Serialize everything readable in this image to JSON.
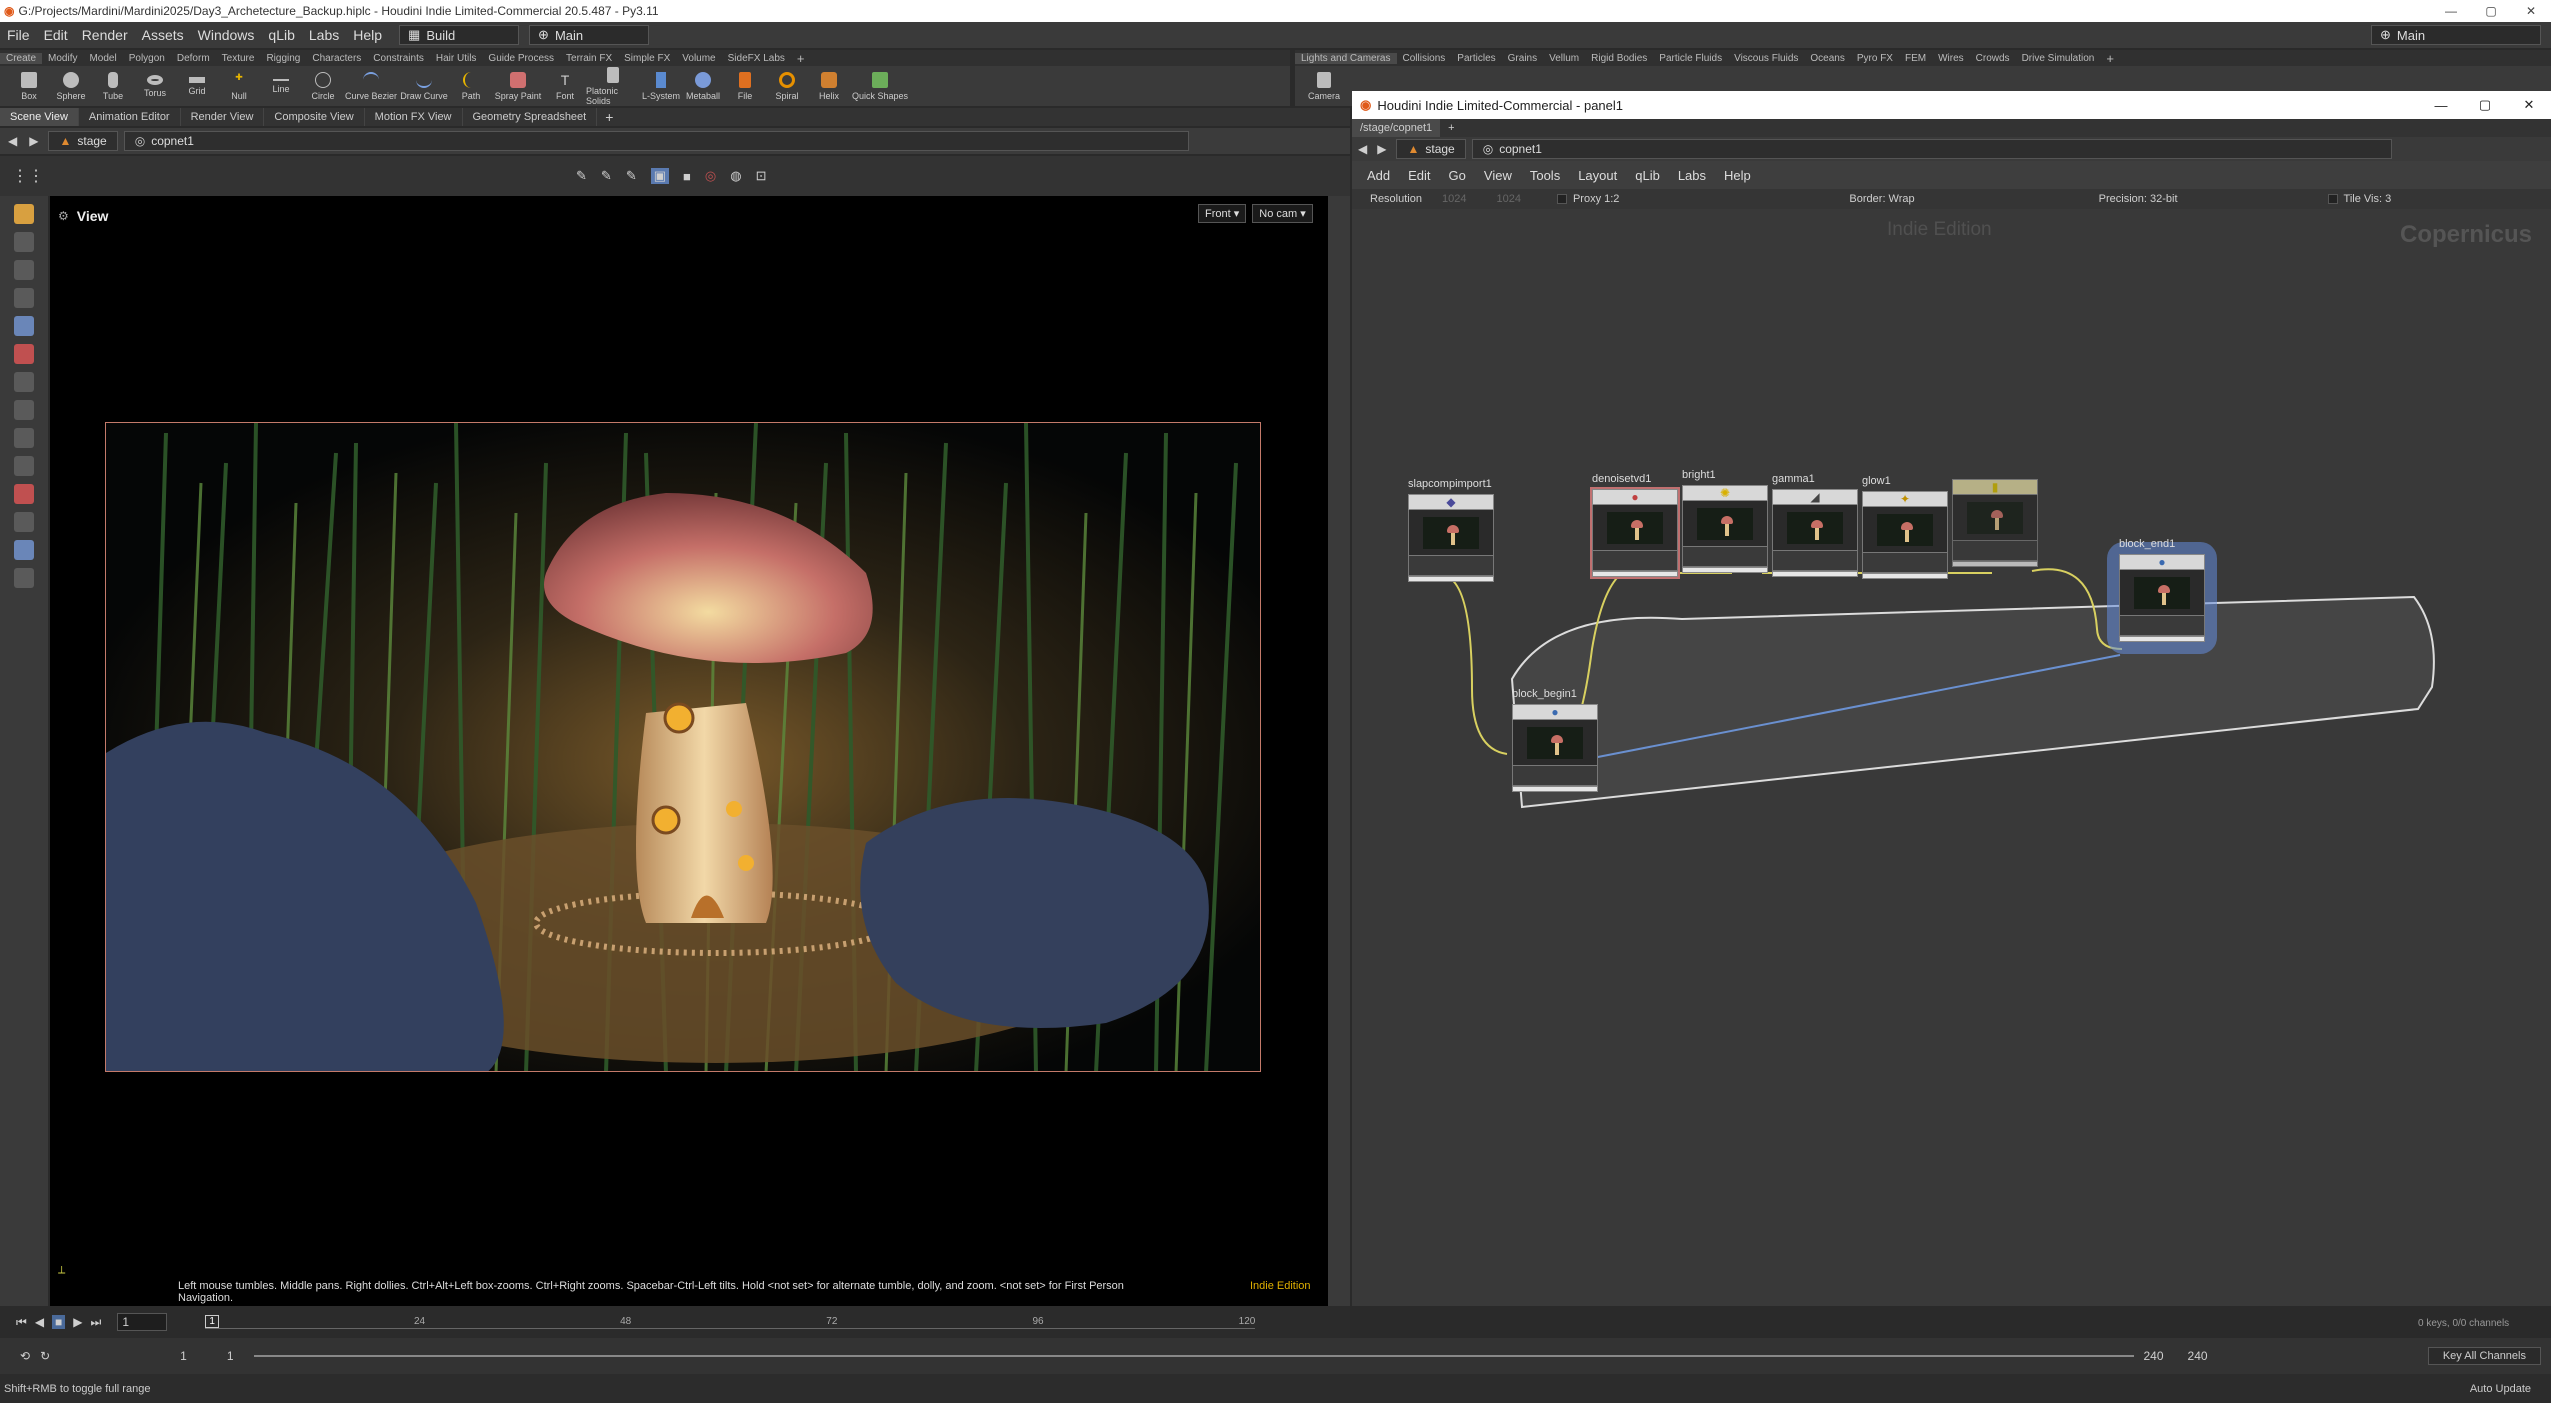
{
  "window": {
    "title": "G:/Projects/Mardini/Mardini2025/Day3_Archetecture_Backup.hiplc - Houdini Indie Limited-Commercial 20.5.487 - Py3.11",
    "minimize": "—",
    "maximize": "▢",
    "close": "✕"
  },
  "menubar": {
    "items": [
      "File",
      "Edit",
      "Render",
      "Assets",
      "Windows",
      "qLib",
      "Labs",
      "Help"
    ],
    "desktop": "Build",
    "context": "Main",
    "right_context": "Main"
  },
  "shelf": {
    "tabs": [
      "Create",
      "Modify",
      "Model",
      "Polygon",
      "Deform",
      "Texture",
      "Rigging",
      "Characters",
      "Constraints",
      "Hair Utils",
      "Guide Process",
      "Terrain FX",
      "Simple FX",
      "Volume",
      "SideFX Labs"
    ],
    "tools": [
      "Box",
      "Sphere",
      "Tube",
      "Torus",
      "Grid",
      "Null",
      "Line",
      "Circle",
      "Curve Bezier",
      "Draw Curve",
      "Path",
      "Spray Paint",
      "Font",
      "Platonic Solids",
      "L-System",
      "Metaball",
      "File",
      "Spiral",
      "Helix",
      "Quick Shapes"
    ],
    "right_tabs": [
      "Lights and Cameras",
      "Collisions",
      "Particles",
      "Grains",
      "Vellum",
      "Rigid Bodies",
      "Particle Fluids",
      "Viscous Fluids",
      "Oceans",
      "Pyro FX",
      "FEM",
      "Wires",
      "Crowds",
      "Drive Simulation"
    ],
    "right_tools": [
      "Camera"
    ]
  },
  "panes": {
    "tabs": [
      "Scene View",
      "Animation Editor",
      "Render View",
      "Composite View",
      "Motion FX View",
      "Geometry Spreadsheet"
    ],
    "path": [
      "stage",
      "copnet1"
    ]
  },
  "viewport": {
    "label": "View",
    "projection": "Front",
    "camera": "No cam",
    "hint": "Left mouse tumbles. Middle pans. Right dollies. Ctrl+Alt+Left box-zooms. Ctrl+Right zooms. Spacebar-Ctrl-Left tilts. Hold <not set> for alternate tumble, dolly, and zoom. <not set> for First Person Navigation.",
    "edition": "Indie Edition"
  },
  "timeline": {
    "frame": "1",
    "ticks": [
      "1",
      "24",
      "48",
      "72",
      "96",
      "120"
    ],
    "start": "1",
    "start2": "1",
    "end": "240",
    "end2": "240",
    "keys": "0 keys, 0/0 channels",
    "key_all": "Key All Channels"
  },
  "status": {
    "left": "Shift+RMB to toggle full range",
    "right": "Auto Update"
  },
  "panel": {
    "title": "Houdini Indie Limited-Commercial - panel1",
    "tab": "/stage/copnet1",
    "path": [
      "stage",
      "copnet1"
    ],
    "menu": [
      "Add",
      "Edit",
      "Go",
      "View",
      "Tools",
      "Layout",
      "qLib",
      "Labs",
      "Help"
    ],
    "params": {
      "resolution_label": "Resolution",
      "res_x": "1024",
      "res_y": "1024",
      "proxy": "Proxy 1:2",
      "border": "Border: Wrap",
      "precision": "Precision: 32-bit",
      "tile": "Tile Vis: 3"
    },
    "watermark": "Indie Edition",
    "context_label": "Copernicus",
    "nodes": [
      "slapcompimport1",
      "denoisetvd1",
      "bright1",
      "gamma1",
      "glow1",
      "",
      "block_begin1",
      "block_end1"
    ]
  }
}
